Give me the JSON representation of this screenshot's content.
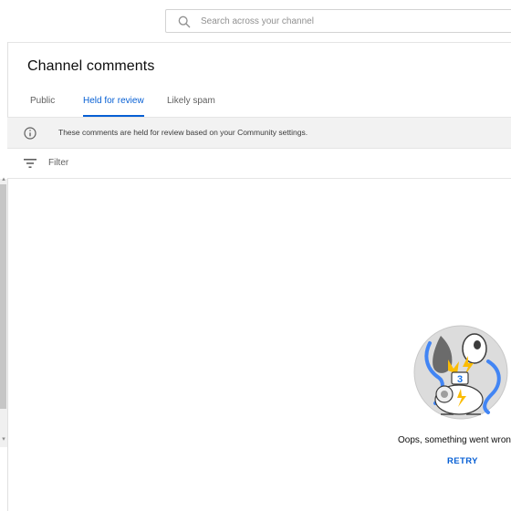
{
  "search": {
    "placeholder": "Search across your channel"
  },
  "page": {
    "title": "Channel comments"
  },
  "tabs": [
    {
      "label": "Public",
      "active": false
    },
    {
      "label": "Held for review",
      "active": true
    },
    {
      "label": "Likely spam",
      "active": false
    }
  ],
  "info_banner": {
    "icon": "info-icon",
    "text": "These comments are held for review based on your Community settings."
  },
  "filter": {
    "icon": "filter-icon",
    "label": "Filter"
  },
  "error": {
    "message": "Oops, something went wrong.",
    "retry_label": "RETRY",
    "illustration": "broken-robot-illustration"
  },
  "colors": {
    "accent": "#065fd4",
    "banner_bg": "#f2f2f2",
    "text_primary": "#0d0d0d",
    "text_secondary": "#606060"
  }
}
